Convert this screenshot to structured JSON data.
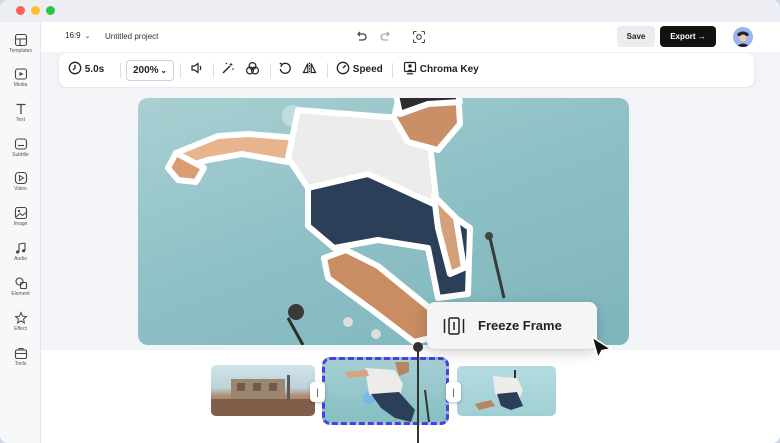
{
  "sidebar": {
    "items": [
      {
        "label": "Templates",
        "icon": "templates-icon"
      },
      {
        "label": "Media",
        "icon": "media-icon"
      },
      {
        "label": "Text",
        "icon": "text-icon"
      },
      {
        "label": "Subtitle",
        "icon": "subtitle-icon"
      },
      {
        "label": "Video",
        "icon": "video-icon"
      },
      {
        "label": "Image",
        "icon": "image-icon"
      },
      {
        "label": "Audio",
        "icon": "audio-icon"
      },
      {
        "label": "Element",
        "icon": "element-icon"
      },
      {
        "label": "Effect",
        "icon": "effect-icon"
      },
      {
        "label": "Tools",
        "icon": "tools-icon"
      }
    ]
  },
  "topbar": {
    "aspect_ratio": "16:9",
    "project_name": "Untitled project",
    "save_label": "Save",
    "export_label": "Export",
    "export_arrow": "→"
  },
  "toolbar": {
    "duration": "5.0s",
    "zoom": "200%",
    "speed_label": "Speed",
    "chroma_key_label": "Chroma Key"
  },
  "timeline": {
    "handle_left": "|",
    "handle_right": "|"
  },
  "popup": {
    "freeze_frame_label": "Freeze Frame"
  },
  "colors": {
    "accent": "#4b3fe0",
    "export_bg": "#111111",
    "video_bg": "#8fc1c6"
  }
}
